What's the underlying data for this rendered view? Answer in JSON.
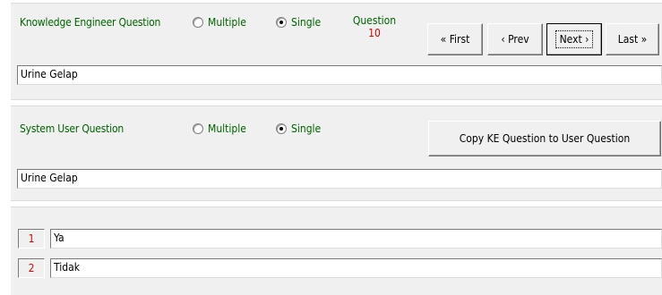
{
  "ke": {
    "label": "Knowledge Engineer Question",
    "radio_multiple": "Multiple",
    "radio_single": "Single",
    "selected": "Single",
    "question_label": "Question",
    "question_number": "10",
    "nav": {
      "first": "« First",
      "prev": "‹ Prev",
      "next": "Next ›",
      "last": "Last »"
    },
    "text": "Urine Gelap"
  },
  "user": {
    "label": "System User Question",
    "radio_multiple": "Multiple",
    "radio_single": "Single",
    "selected": "Single",
    "copy_button": "Copy KE Question to User Question",
    "text": "Urine Gelap"
  },
  "answers": [
    {
      "number": "1",
      "text": "Ya"
    },
    {
      "number": "2",
      "text": "Tidak"
    }
  ]
}
